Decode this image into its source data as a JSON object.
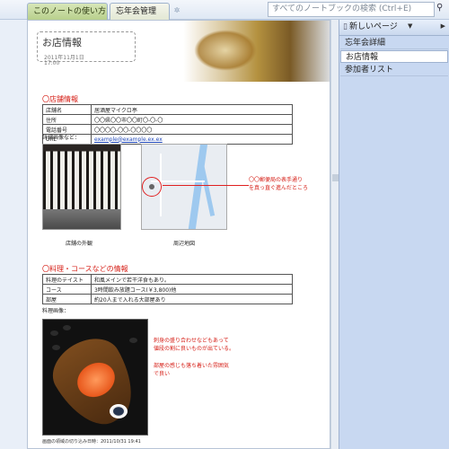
{
  "tabs": {
    "tab1": "このノートの使い方",
    "tab2": "忘年会管理"
  },
  "search": {
    "placeholder": "すべてのノートブックの検索 (Ctrl+E)"
  },
  "page": {
    "title": "お店情報",
    "date": "2011年11月1日",
    "time": "17:00",
    "shop_section": "〇店舗情報",
    "shop_table": [
      {
        "key": "店舗名",
        "value": "居酒屋マイクロ亭"
      },
      {
        "key": "住所",
        "value": "〇〇県〇〇市〇〇町〇-〇-〇"
      },
      {
        "key": "電話番号",
        "value": "〇〇〇〇-〇〇-〇〇〇〇"
      },
      {
        "key": "URL",
        "value": "example@example.ex.ex"
      }
    ],
    "detail_images_label": "詳細画像など：",
    "shop_photo_caption": "店舗の外観",
    "map_caption": "周辺地図",
    "map_note_1": "〇〇郵便局の表手通り",
    "map_note_2": "を真っ直ぐ進んだところ",
    "food_section": "〇料理・コースなどの情報",
    "food_table": [
      {
        "key": "料理のテイスト",
        "value": "和風メインで若干洋食もあり。"
      },
      {
        "key": "コース",
        "value": "3時間飲み放題コース(￥3,800)他"
      },
      {
        "key": "部屋",
        "value": "約20人まで入れる大部屋あり"
      }
    ],
    "food_images_label": "料理画像：",
    "food_note_1": "刺身の盛り合わせなどもあって",
    "food_note_2": "値段の割に良いものが出ている。",
    "food_note_3": "部屋の感じも落ち着いた雰囲気",
    "food_note_4": "で良い",
    "food_caption": "画面の領域の切り込み日時：2011/10/31 19:41"
  },
  "right_pane": {
    "new_page": "新しいページ",
    "pages": [
      "忘年会詳細",
      "お店情報",
      "参加者リスト"
    ]
  }
}
